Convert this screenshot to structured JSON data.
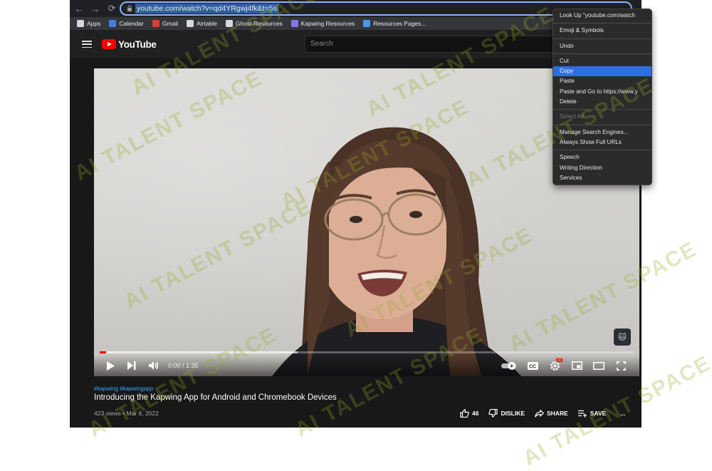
{
  "browser": {
    "back_icon": "←",
    "forward_icon": "→",
    "reload_icon": "⟳",
    "url": "youtube.com/watch?v=qd4YRgwj4fk&t=5s"
  },
  "bookmarks": [
    {
      "label": "Apps",
      "icon": "apps-grid-icon",
      "color": "#e8eaed"
    },
    {
      "label": "Calendar",
      "icon": "calendar-icon",
      "color": "#4285f4"
    },
    {
      "label": "Gmail",
      "icon": "gmail-icon",
      "color": "#ea4335"
    },
    {
      "label": "Airtable",
      "icon": "airtable-icon",
      "color": "#e8eaed"
    },
    {
      "label": "Ghost Resources",
      "icon": "ghost-icon",
      "color": "#e8eaed"
    },
    {
      "label": "Kapwing Resources",
      "icon": "kapwing-icon",
      "color": "#8f7dff"
    },
    {
      "label": "Resources Pages...",
      "icon": "pages-icon",
      "color": "#4aa3ff"
    }
  ],
  "youtube": {
    "logo_text": "YouTube",
    "search_placeholder": "Search"
  },
  "video": {
    "time": "0:00 / 1:35",
    "progress_played": 0.012,
    "progress_buffered": 0.37,
    "settings_badge": "HD"
  },
  "details": {
    "hashtags": "#kapwing #kapwingapp",
    "title": "Introducing the Kapwing App for Android and Chromebook Devices",
    "meta": "423 views • Mar 8, 2022",
    "likes": "46",
    "dislike_label": "DISLIKE",
    "share_label": "SHARE",
    "save_label": "SAVE",
    "more": "..."
  },
  "context_menu": {
    "groups": [
      [
        {
          "label": "Look Up “youtube.com/watch",
          "state": "normal"
        }
      ],
      [
        {
          "label": "Emoji & Symbols",
          "state": "normal"
        }
      ],
      [
        {
          "label": "Undo",
          "state": "normal"
        }
      ],
      [
        {
          "label": "Cut",
          "state": "normal"
        },
        {
          "label": "Copy",
          "state": "highlighted"
        },
        {
          "label": "Paste",
          "state": "normal"
        },
        {
          "label": "Paste and Go to https://www.y",
          "state": "normal"
        },
        {
          "label": "Delete",
          "state": "normal"
        }
      ],
      [
        {
          "label": "Select All",
          "state": "disabled"
        }
      ],
      [
        {
          "label": "Manage Search Engines...",
          "state": "normal"
        },
        {
          "label": "Always Show Full URLs",
          "state": "normal"
        }
      ],
      [
        {
          "label": "Speech",
          "state": "normal"
        },
        {
          "label": "Writing Direction",
          "state": "normal"
        },
        {
          "label": "Services",
          "state": "normal"
        }
      ]
    ]
  },
  "watermark": "AI TALENT SPACE"
}
